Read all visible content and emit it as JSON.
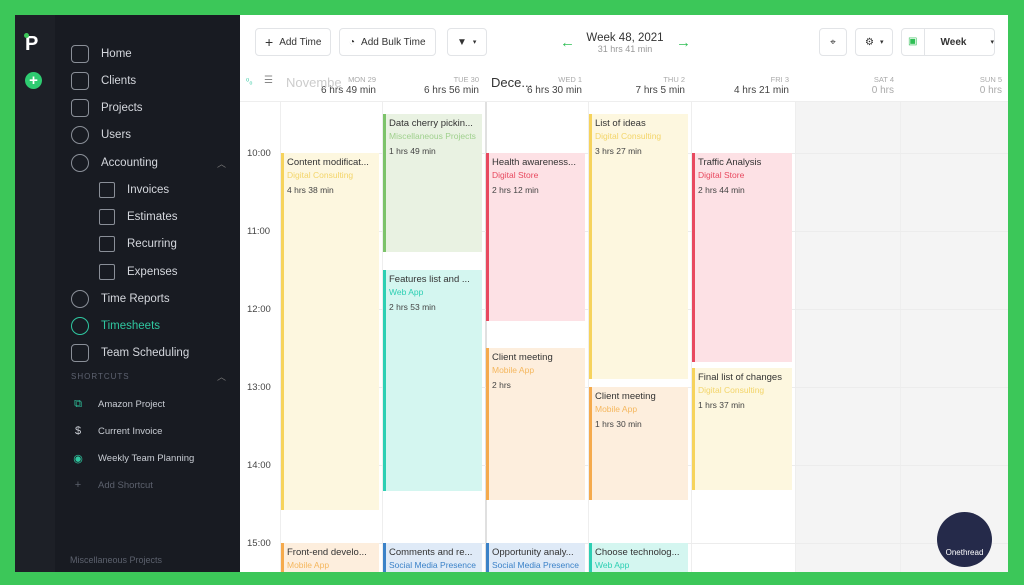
{
  "sidebar": {
    "logo": "P",
    "items": [
      {
        "label": "Home",
        "icon": "home-icon"
      },
      {
        "label": "Clients",
        "icon": "building-icon"
      },
      {
        "label": "Projects",
        "icon": "folder-icon"
      },
      {
        "label": "Users",
        "icon": "user-circle-icon"
      },
      {
        "label": "Accounting",
        "icon": "dollar-circle-icon"
      },
      {
        "label": "Invoices",
        "icon": "invoice-icon",
        "sub": true
      },
      {
        "label": "Estimates",
        "icon": "estimate-icon",
        "sub": true
      },
      {
        "label": "Recurring",
        "icon": "recurring-icon",
        "sub": true
      },
      {
        "label": "Expenses",
        "icon": "wallet-icon",
        "sub": true
      },
      {
        "label": "Time Reports",
        "icon": "pie-chart-icon"
      },
      {
        "label": "Timesheets",
        "icon": "clock-icon",
        "active": true
      },
      {
        "label": "Team Scheduling",
        "icon": "calendar-icon"
      }
    ],
    "shortcuts_header": "SHORTCUTS",
    "shortcuts": [
      {
        "label": "Amazon Project",
        "icon": "link-icon",
        "glyph": "⧉"
      },
      {
        "label": "Current Invoice",
        "icon": "dollar-icon",
        "glyph": "$"
      },
      {
        "label": "Weekly Team Planning",
        "icon": "user-icon",
        "glyph": "◉"
      },
      {
        "label": "Add Shortcut",
        "icon": "plus-icon",
        "glyph": "+"
      }
    ],
    "footer": "Miscellaneous Projects"
  },
  "toolbar": {
    "add_time": "Add Time",
    "add_bulk_time": "Add Bulk Time",
    "week_title": "Week 48, 2021",
    "week_total": "31 hrs 41 min",
    "view": "Week"
  },
  "calendar": {
    "months": [
      "Novembe",
      "Dece..."
    ],
    "days": [
      {
        "label": "MON 29",
        "total": "6 hrs 49 min"
      },
      {
        "label": "TUE 30",
        "total": "6 hrs 56 min"
      },
      {
        "label": "WED 1",
        "total": "6 hrs 30 min"
      },
      {
        "label": "THU 2",
        "total": "7 hrs 5 min"
      },
      {
        "label": "FRI 3",
        "total": "4 hrs 21 min"
      },
      {
        "label": "SAT 4",
        "total": "0 hrs"
      },
      {
        "label": "SUN 5",
        "total": "0 hrs"
      }
    ],
    "hours": [
      "10:00",
      "11:00",
      "12:00",
      "13:00",
      "14:00",
      "15:00"
    ],
    "events": [
      {
        "day": 0,
        "start": "10:00",
        "end": "14:38",
        "title": "Content modificat...",
        "project": "Digital Consulting",
        "duration": "4 hrs 38 min",
        "color": "yellow"
      },
      {
        "day": 1,
        "start": "9:30",
        "end": "11:19",
        "title": "Data cherry pickin...",
        "project": "Miscellaneous Projects",
        "duration": "1 hrs 49 min",
        "color": "green"
      },
      {
        "day": 1,
        "start": "11:30",
        "end": "14:23",
        "title": "Features list and ...",
        "project": "Web App",
        "duration": "2 hrs 53 min",
        "color": "teal"
      },
      {
        "day": 2,
        "start": "10:00",
        "end": "12:12",
        "title": "Health awareness...",
        "project": "Digital Store",
        "duration": "2 hrs 12 min",
        "color": "pink"
      },
      {
        "day": 2,
        "start": "12:30",
        "end": "14:30",
        "title": "Client meeting",
        "project": "Mobile App",
        "duration": "2 hrs",
        "color": "orange"
      },
      {
        "day": 3,
        "start": "9:30",
        "end": "12:57",
        "title": "List of ideas",
        "project": "Digital Consulting",
        "duration": "3 hrs 27 min",
        "color": "yellow"
      },
      {
        "day": 3,
        "start": "13:00",
        "end": "14:30",
        "title": "Client meeting",
        "project": "Mobile App",
        "duration": "1 hrs 30 min",
        "color": "orange"
      },
      {
        "day": 4,
        "start": "10:00",
        "end": "12:44",
        "title": "Traffic Analysis",
        "project": "Digital Store",
        "duration": "2 hrs 44 min",
        "color": "pink"
      },
      {
        "day": 4,
        "start": "12:45",
        "end": "14:22",
        "title": "Final list of changes",
        "project": "Digital Consulting",
        "duration": "1 hrs 37 min",
        "color": "yellow"
      },
      {
        "day": 0,
        "start": "15:00",
        "end": "16:00",
        "title": "Front-end develo...",
        "project": "Mobile App",
        "duration": "",
        "color": "orange"
      },
      {
        "day": 1,
        "start": "15:00",
        "end": "16:00",
        "title": "Comments and re...",
        "project": "Social Media Presence",
        "duration": "",
        "color": "blue"
      },
      {
        "day": 2,
        "start": "15:00",
        "end": "16:00",
        "title": "Opportunity analy...",
        "project": "Social Media Presence",
        "duration": "",
        "color": "blue"
      },
      {
        "day": 3,
        "start": "15:00",
        "end": "16:00",
        "title": "Choose technolog...",
        "project": "Web App",
        "duration": "",
        "color": "teal"
      }
    ]
  },
  "colors": {
    "yellow": [
      "#fdf7df",
      "#f6d35c",
      "#f3d56a"
    ],
    "green": [
      "#e9f2e2",
      "#7cc36a",
      "#9fd08d"
    ],
    "teal": [
      "#d4f6f0",
      "#2dcfb3",
      "#2dcfb3"
    ],
    "pink": [
      "#fde1e5",
      "#e8495f",
      "#e8495f"
    ],
    "orange": [
      "#fdeedd",
      "#f5aa4c",
      "#f5b75e"
    ],
    "blue": [
      "#dfeaf7",
      "#3b82c8",
      "#3b82c8"
    ],
    "accent": "#2fc7a0"
  },
  "watermark": "Onethread"
}
